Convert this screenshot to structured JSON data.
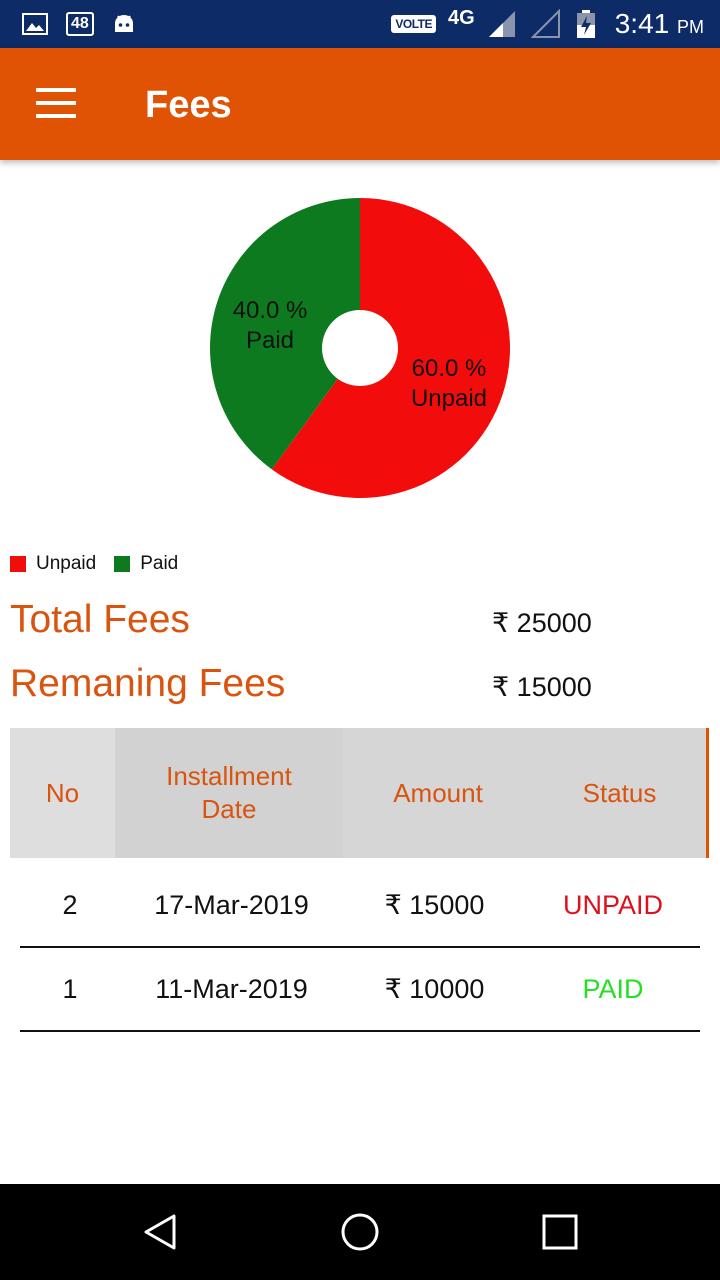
{
  "status_bar": {
    "badge": "48",
    "volte": "VOLTE",
    "network": "4G",
    "time": "3:41",
    "ampm": "PM",
    "icons": [
      "image-icon",
      "battery-badge",
      "android-icon",
      "signal-icon",
      "battery-icon"
    ]
  },
  "app_bar": {
    "title": "Fees",
    "menu_icon": "hamburger-menu-icon",
    "color": "#e05204"
  },
  "chart_data": {
    "type": "pie",
    "donut": true,
    "categories": [
      "Unpaid",
      "Paid"
    ],
    "values": [
      60.0,
      40.0
    ],
    "colors": [
      "#f20c0c",
      "#0e7a1f"
    ],
    "slice_labels": [
      {
        "percent": "60.0 %",
        "name": "Unpaid"
      },
      {
        "percent": "40.0 %",
        "name": "Paid"
      }
    ],
    "legend": [
      "Unpaid",
      "Paid"
    ],
    "legend_position": "bottom-left"
  },
  "summary": {
    "total_label": "Total Fees",
    "total_value": "₹ 25000",
    "remaining_label": "Remaning Fees",
    "remaining_value": "₹ 15000"
  },
  "table": {
    "headers": [
      "No",
      "Installment Date",
      "Amount",
      "Status"
    ],
    "rows": [
      {
        "no": "2",
        "date": "17-Mar-2019",
        "amount": "₹ 15000",
        "status": "UNPAID",
        "status_color": "#e0101a"
      },
      {
        "no": "1",
        "date": "11-Mar-2019",
        "amount": "₹ 10000",
        "status": "PAID",
        "status_color": "#22e022"
      }
    ]
  },
  "nav_bar": {
    "buttons": [
      "back-icon",
      "home-icon",
      "recents-icon"
    ]
  }
}
